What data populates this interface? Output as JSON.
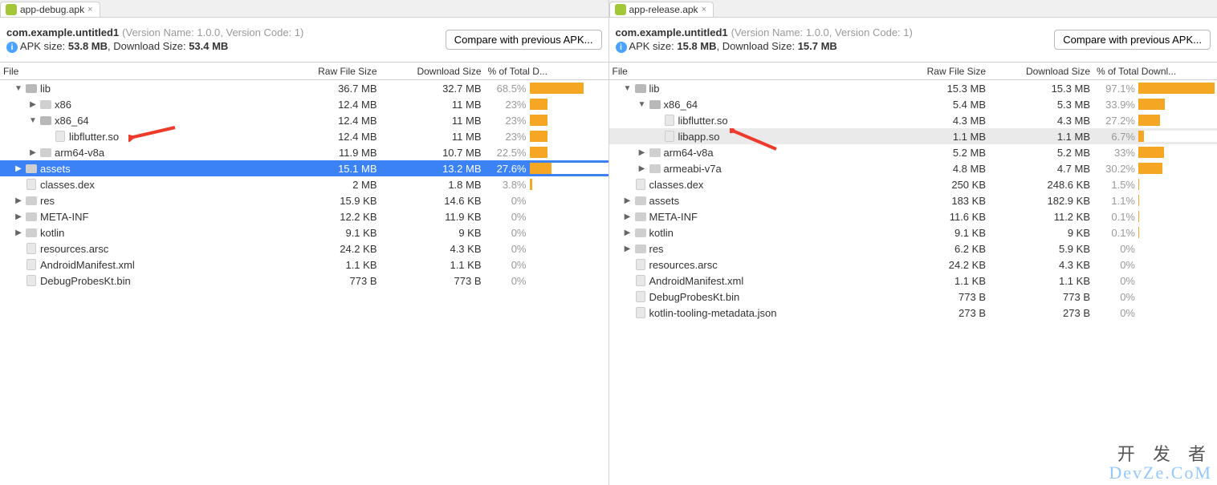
{
  "left": {
    "tab": "app-debug.apk",
    "package": "com.example.untitled1",
    "version": "(Version Name: 1.0.0, Version Code: 1)",
    "sizes_label": "APK size:",
    "apk_size": "53.8 MB",
    "dl_label": ", Download Size:",
    "dl_size": "53.4 MB",
    "compare_btn": "Compare with previous APK...",
    "headers": {
      "file": "File",
      "raw": "Raw File Size",
      "dl": "Download Size",
      "pct": "% of Total D..."
    },
    "rows": [
      {
        "indent": 1,
        "arrow": "down",
        "icon": "folder",
        "name": "lib",
        "raw": "36.7 MB",
        "dl": "32.7 MB",
        "pct": "68.5%",
        "bar": 68.5
      },
      {
        "indent": 2,
        "arrow": "right",
        "icon": "folder",
        "name": "x86",
        "raw": "12.4 MB",
        "dl": "11 MB",
        "pct": "23%",
        "bar": 23
      },
      {
        "indent": 2,
        "arrow": "down",
        "icon": "folder",
        "name": "x86_64",
        "raw": "12.4 MB",
        "dl": "11 MB",
        "pct": "23%",
        "bar": 23
      },
      {
        "indent": 3,
        "arrow": "",
        "icon": "file",
        "name": "libflutter.so",
        "raw": "12.4 MB",
        "dl": "11 MB",
        "pct": "23%",
        "bar": 23,
        "annot_arrow": true
      },
      {
        "indent": 2,
        "arrow": "right",
        "icon": "folder",
        "name": "arm64-v8a",
        "raw": "11.9 MB",
        "dl": "10.7 MB",
        "pct": "22.5%",
        "bar": 22.5
      },
      {
        "indent": 1,
        "arrow": "right",
        "icon": "folder",
        "name": "assets",
        "raw": "15.1 MB",
        "dl": "13.2 MB",
        "pct": "27.6%",
        "bar": 27.6,
        "selected": true
      },
      {
        "indent": 1,
        "arrow": "",
        "icon": "file",
        "name": "classes.dex",
        "raw": "2 MB",
        "dl": "1.8 MB",
        "pct": "3.8%",
        "bar": 3.8
      },
      {
        "indent": 1,
        "arrow": "right",
        "icon": "folder",
        "name": "res",
        "raw": "15.9 KB",
        "dl": "14.6 KB",
        "pct": "0%",
        "bar": 0
      },
      {
        "indent": 1,
        "arrow": "right",
        "icon": "folder",
        "name": "META-INF",
        "raw": "12.2 KB",
        "dl": "11.9 KB",
        "pct": "0%",
        "bar": 0
      },
      {
        "indent": 1,
        "arrow": "right",
        "icon": "folder",
        "name": "kotlin",
        "raw": "9.1 KB",
        "dl": "9 KB",
        "pct": "0%",
        "bar": 0
      },
      {
        "indent": 1,
        "arrow": "",
        "icon": "file",
        "name": "resources.arsc",
        "raw": "24.2 KB",
        "dl": "4.3 KB",
        "pct": "0%",
        "bar": 0
      },
      {
        "indent": 1,
        "arrow": "",
        "icon": "file",
        "name": "AndroidManifest.xml",
        "raw": "1.1 KB",
        "dl": "1.1 KB",
        "pct": "0%",
        "bar": 0
      },
      {
        "indent": 1,
        "arrow": "",
        "icon": "file",
        "name": "DebugProbesKt.bin",
        "raw": "773 B",
        "dl": "773 B",
        "pct": "0%",
        "bar": 0
      }
    ]
  },
  "right": {
    "tab": "app-release.apk",
    "package": "com.example.untitled1",
    "version": "(Version Name: 1.0.0, Version Code: 1)",
    "sizes_label": "APK size:",
    "apk_size": "15.8 MB",
    "dl_label": ", Download Size:",
    "dl_size": "15.7 MB",
    "compare_btn": "Compare with previous APK...",
    "headers": {
      "file": "File",
      "raw": "Raw File Size",
      "dl": "Download Size",
      "pct": "% of Total Downl..."
    },
    "rows": [
      {
        "indent": 1,
        "arrow": "down",
        "icon": "folder",
        "name": "lib",
        "raw": "15.3 MB",
        "dl": "15.3 MB",
        "pct": "97.1%",
        "bar": 97.1
      },
      {
        "indent": 2,
        "arrow": "down",
        "icon": "folder",
        "name": "x86_64",
        "raw": "5.4 MB",
        "dl": "5.3 MB",
        "pct": "33.9%",
        "bar": 33.9
      },
      {
        "indent": 3,
        "arrow": "",
        "icon": "file",
        "name": "libflutter.so",
        "raw": "4.3 MB",
        "dl": "4.3 MB",
        "pct": "27.2%",
        "bar": 27.2
      },
      {
        "indent": 3,
        "arrow": "",
        "icon": "file",
        "name": "libapp.so",
        "raw": "1.1 MB",
        "dl": "1.1 MB",
        "pct": "6.7%",
        "bar": 6.7,
        "highlight": true,
        "annot_arrow": true
      },
      {
        "indent": 2,
        "arrow": "right",
        "icon": "folder",
        "name": "arm64-v8a",
        "raw": "5.2 MB",
        "dl": "5.2 MB",
        "pct": "33%",
        "bar": 33
      },
      {
        "indent": 2,
        "arrow": "right",
        "icon": "folder",
        "name": "armeabi-v7a",
        "raw": "4.8 MB",
        "dl": "4.7 MB",
        "pct": "30.2%",
        "bar": 30.2
      },
      {
        "indent": 1,
        "arrow": "",
        "icon": "file",
        "name": "classes.dex",
        "raw": "250 KB",
        "dl": "248.6 KB",
        "pct": "1.5%",
        "bar": 1.5
      },
      {
        "indent": 1,
        "arrow": "right",
        "icon": "folder",
        "name": "assets",
        "raw": "183 KB",
        "dl": "182.9 KB",
        "pct": "1.1%",
        "bar": 1.1
      },
      {
        "indent": 1,
        "arrow": "right",
        "icon": "folder",
        "name": "META-INF",
        "raw": "11.6 KB",
        "dl": "11.2 KB",
        "pct": "0.1%",
        "bar": 0.1
      },
      {
        "indent": 1,
        "arrow": "right",
        "icon": "folder",
        "name": "kotlin",
        "raw": "9.1 KB",
        "dl": "9 KB",
        "pct": "0.1%",
        "bar": 0.1
      },
      {
        "indent": 1,
        "arrow": "right",
        "icon": "folder",
        "name": "res",
        "raw": "6.2 KB",
        "dl": "5.9 KB",
        "pct": "0%",
        "bar": 0
      },
      {
        "indent": 1,
        "arrow": "",
        "icon": "file",
        "name": "resources.arsc",
        "raw": "24.2 KB",
        "dl": "4.3 KB",
        "pct": "0%",
        "bar": 0
      },
      {
        "indent": 1,
        "arrow": "",
        "icon": "file",
        "name": "AndroidManifest.xml",
        "raw": "1.1 KB",
        "dl": "1.1 KB",
        "pct": "0%",
        "bar": 0
      },
      {
        "indent": 1,
        "arrow": "",
        "icon": "file",
        "name": "DebugProbesKt.bin",
        "raw": "773 B",
        "dl": "773 B",
        "pct": "0%",
        "bar": 0
      },
      {
        "indent": 1,
        "arrow": "",
        "icon": "file",
        "name": "kotlin-tooling-metadata.json",
        "raw": "273 B",
        "dl": "273 B",
        "pct": "0%",
        "bar": 0
      }
    ]
  },
  "watermark_top": "开 发 者",
  "watermark_bottom": "DevZe.CoM"
}
